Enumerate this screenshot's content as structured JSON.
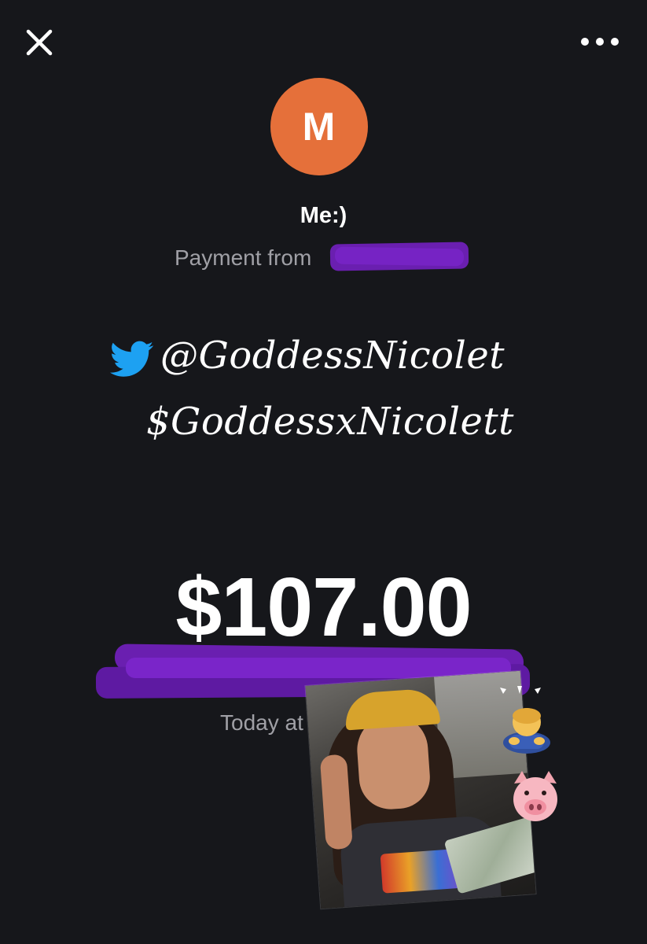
{
  "header": {
    "close_icon": "close-icon",
    "more_icon": "more-horizontal-icon"
  },
  "profile": {
    "avatar_initial": "M",
    "avatar_color": "#e5703a",
    "name": "Me:)"
  },
  "payment": {
    "from_label": "Payment from",
    "amount": "$107.00",
    "time_label": "Today at"
  },
  "overlay_text": {
    "twitter_handle": "@GoddessNicolet",
    "cashtag": "$GoddessxNicolett",
    "twitter_icon": "twitter-bird-icon"
  },
  "stickers": {
    "photo": "selfie-photo-sticker",
    "emoji_1": "person-bowing-emoji",
    "emoji_2": "pig-face-emoji"
  },
  "colors": {
    "background": "#16171b",
    "redaction": "#6a1fb0",
    "twitter_blue": "#1da1f2"
  }
}
